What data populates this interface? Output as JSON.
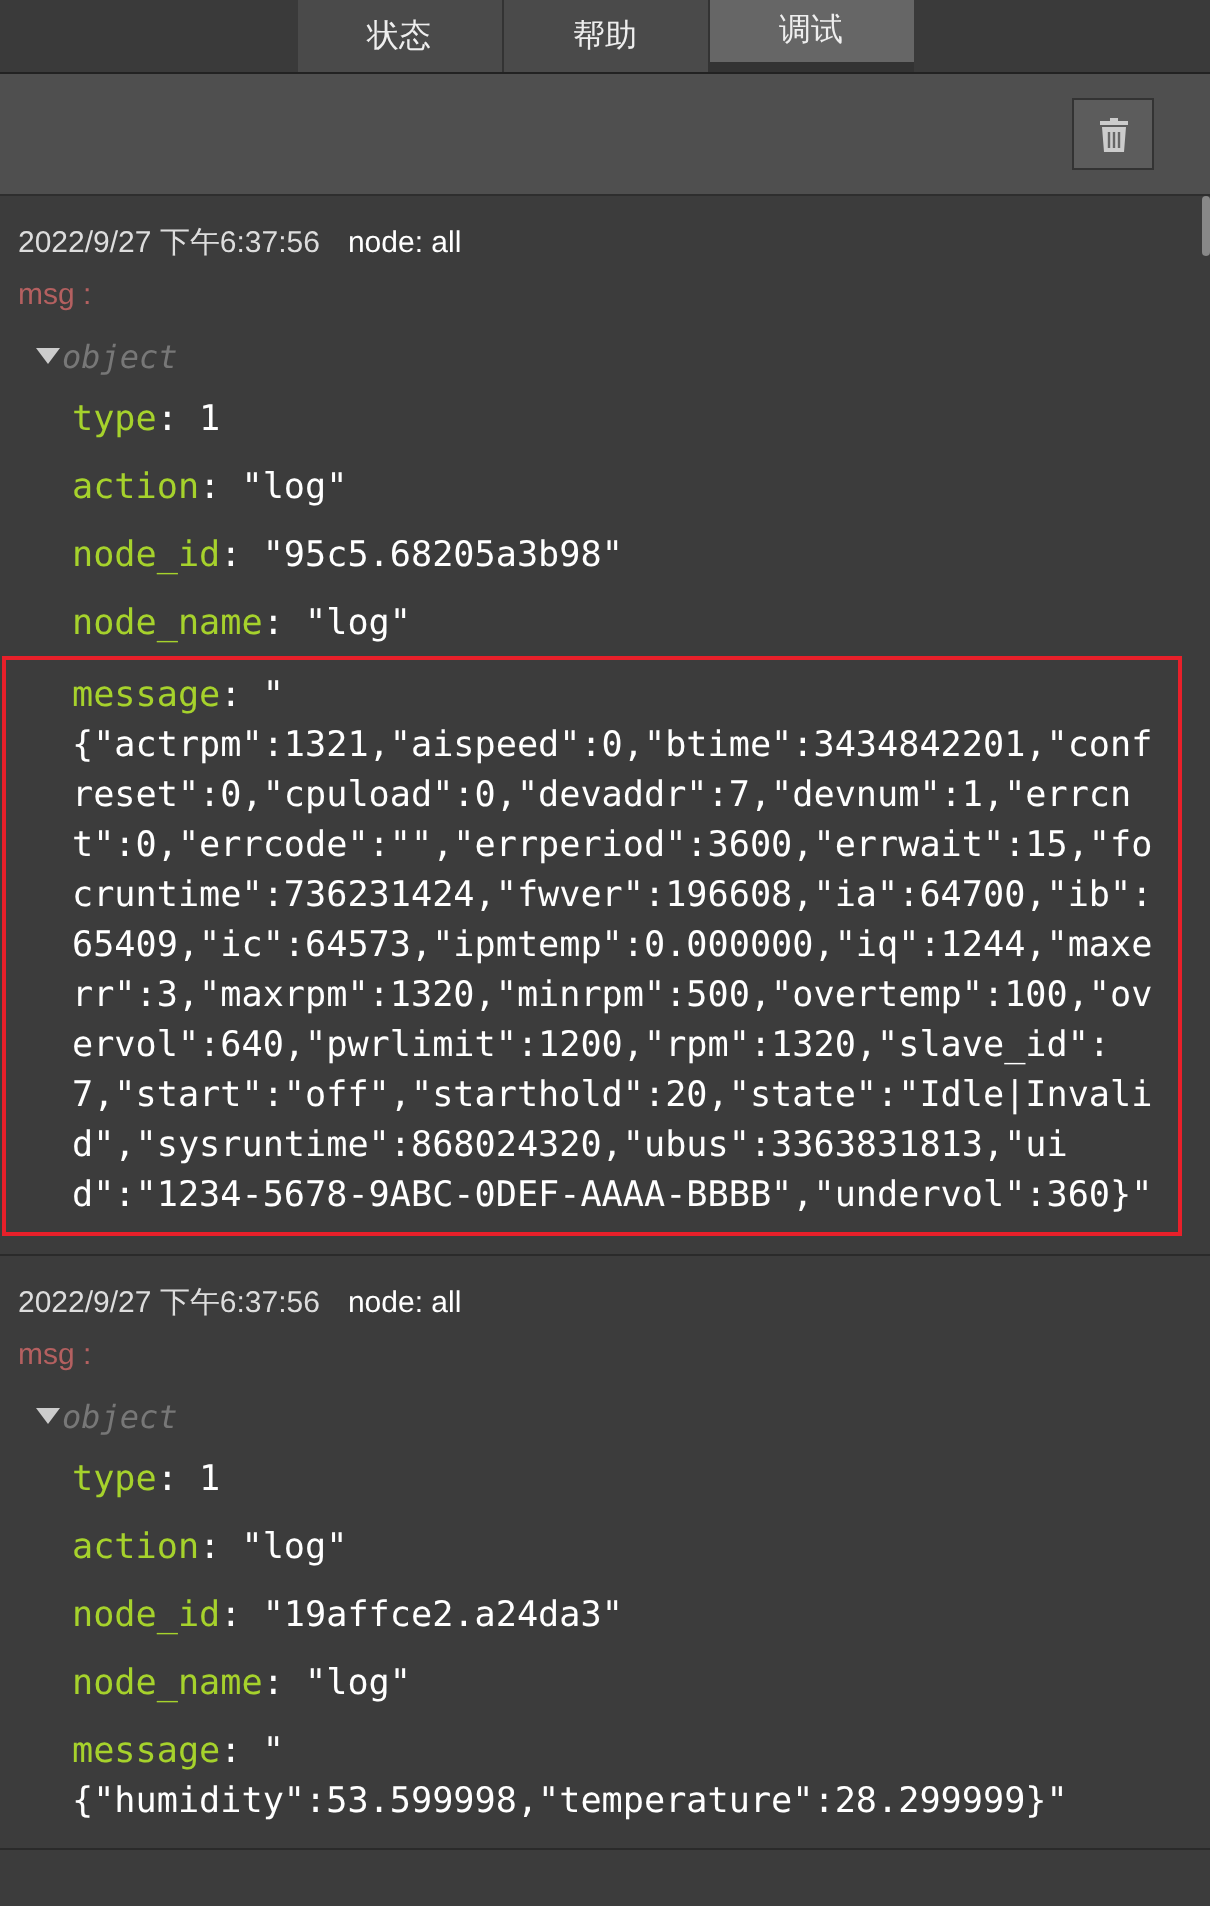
{
  "tabs": [
    {
      "label": "状态",
      "selected": false
    },
    {
      "label": "帮助",
      "selected": false
    },
    {
      "label": "调试",
      "selected": true
    }
  ],
  "messages": [
    {
      "timestamp": "2022/9/27 下午6:37:56",
      "node": "node: all",
      "label": "msg :",
      "object_type": "object",
      "expanded": true,
      "fields": [
        {
          "key": "type",
          "value": ": 1",
          "highlighted": false
        },
        {
          "key": "action",
          "value": ": \"log\"",
          "highlighted": false
        },
        {
          "key": "node_id",
          "value": ": \"95c5.68205a3b98\"",
          "highlighted": false
        },
        {
          "key": "node_name",
          "value": ": \"log\"",
          "highlighted": false
        },
        {
          "key": "message",
          "value": ": \"\n{\"actrpm\":1321,\"aispeed\":0,\"btime\":3434842201,\"confreset\":0,\"cpuload\":0,\"devaddr\":7,\"devnum\":1,\"errcnt\":0,\"errcode\":\"\",\"errperiod\":3600,\"errwait\":15,\"focruntime\":736231424,\"fwver\":196608,\"ia\":64700,\"ib\":65409,\"ic\":64573,\"ipmtemp\":0.000000,\"iq\":1244,\"maxerr\":3,\"maxrpm\":1320,\"minrpm\":500,\"overtemp\":100,\"overvol\":640,\"pwrlimit\":1200,\"rpm\":1320,\"slave_id\":7,\"start\":\"off\",\"starthold\":20,\"state\":\"Idle|Invalid\",\"sysruntime\":868024320,\"ubus\":3363831813,\"uid\":\"1234-5678-9ABC-0DEF-AAAA-BBBB\",\"undervol\":360}\"",
          "highlighted": true
        }
      ]
    },
    {
      "timestamp": "2022/9/27 下午6:37:56",
      "node": "node: all",
      "label": "msg :",
      "object_type": "object",
      "expanded": true,
      "fields": [
        {
          "key": "type",
          "value": ": 1",
          "highlighted": false
        },
        {
          "key": "action",
          "value": ": \"log\"",
          "highlighted": false
        },
        {
          "key": "node_id",
          "value": ": \"19affce2.a24da3\"",
          "highlighted": false
        },
        {
          "key": "node_name",
          "value": ": \"log\"",
          "highlighted": false
        },
        {
          "key": "message",
          "value": ": \"\n{\"humidity\":53.599998,\"temperature\":28.299999}\"",
          "highlighted": false
        }
      ]
    }
  ]
}
